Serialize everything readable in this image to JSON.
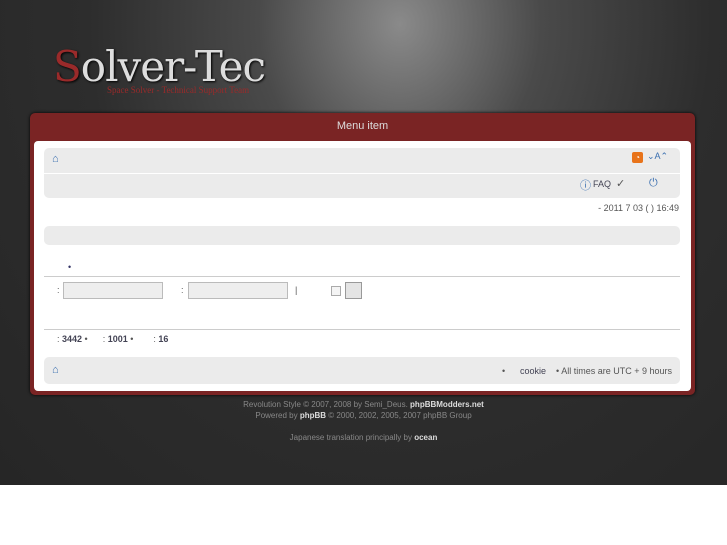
{
  "header": {
    "logo_first": "S",
    "logo_rest": "olver-Tec",
    "tagline": "Space Solver - Technical Support Team"
  },
  "menu": {
    "title": "Menu item"
  },
  "navbar": {
    "faq": "FAQ",
    "datetime": "- 2011 7 03 ( ) 16:49"
  },
  "login": {
    "sep": ":",
    "pipe": "|"
  },
  "stats": {
    "posts": "3442",
    "topics": "1001",
    "members": "16"
  },
  "footer_bar": {
    "cookie": "cookie",
    "timezone": "• All times are UTC + 9 hours"
  },
  "credits": {
    "line1_prefix": "Revolution Style © 2007, 2008 by Semi_Deus.",
    "line1_link": "phpBBModders.net",
    "line2_prefix": "Powered by",
    "line2_link": "phpBB",
    "line2_suffix": "© 2000, 2002, 2005, 2007 phpBB Group",
    "line3_prefix": "Japanese translation principally by",
    "line3_link": "ocean"
  }
}
